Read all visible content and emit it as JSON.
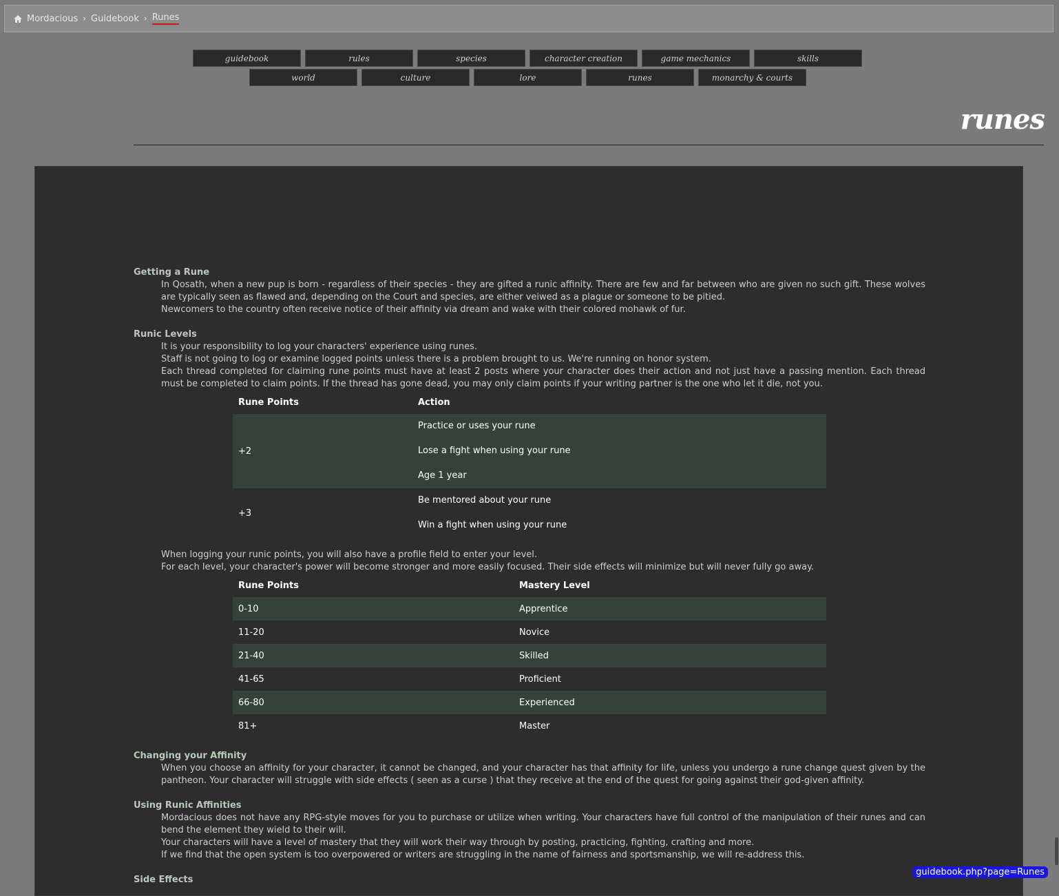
{
  "breadcrumb": {
    "items": [
      "Mordacious",
      "Guidebook"
    ],
    "current": "Runes"
  },
  "nav": {
    "row1": [
      "guidebook",
      "rules",
      "species",
      "character creation",
      "game mechanics",
      "skills"
    ],
    "row2": [
      "world",
      "culture",
      "lore",
      "runes",
      "monarchy & courts"
    ]
  },
  "page_title": "runes",
  "getting_rune": {
    "heading": "Getting a Rune",
    "p1": "In Qosath, when a new pup is born - regardless of their species - they are gifted a runic affinity. There are few and far between who are given no such gift. These wolves are typically seen as flawed and, depending on the Court and species, are either veiwed as a plague or someone to be pitied.",
    "p2": "Newcomers to the country often receive notice of their affinity via dream and wake with their colored mohawk of fur."
  },
  "runic_levels": {
    "heading": "Runic Levels",
    "p1": "It is your responsibility to log your characters' experience using runes.",
    "p2": "Staff is not going to log or examine logged points unless there is a problem brought to us. We're running on honor system.",
    "p3": "Each thread completed for claiming rune points must have at least 2 posts where your character does their action and not just have a passing mention. Each thread must be completed to claim points. If the thread has gone dead, you may only claim points if your writing partner is the one who let it die, not you."
  },
  "points_table": {
    "headers": [
      "Rune Points",
      "Action"
    ],
    "rows": [
      {
        "points": "+2",
        "actions": [
          "Practice or uses your rune",
          "Lose a fight when using your rune",
          "Age 1 year"
        ]
      },
      {
        "points": "+3",
        "actions": [
          "Be mentored about your rune",
          "Win a fight when using your rune"
        ]
      }
    ]
  },
  "levels_intro": {
    "p1": "When logging your runic points, you will also have a profile field to enter your level.",
    "p2": "For each level, your character's power will become stronger and more easily focused. Their side effects will minimize but will never fully go away."
  },
  "levels_table": {
    "headers": [
      "Rune Points",
      "Mastery Level"
    ],
    "rows": [
      [
        "0-10",
        "Apprentice"
      ],
      [
        "11-20",
        "Novice"
      ],
      [
        "21-40",
        "Skilled"
      ],
      [
        "41-65",
        "Proficient"
      ],
      [
        "66-80",
        "Experienced"
      ],
      [
        "81+",
        "Master"
      ]
    ]
  },
  "changing_affinity": {
    "heading": "Changing your Affinity",
    "p1": "When you choose an affinity for your character, it cannot be changed, and your character has that affinity for life, unless you undergo a rune change quest given by the pantheon. Your character will struggle with side effects ( seen as a curse ) that they receive at the end of the quest for going against their god-given affinity."
  },
  "using_affinities": {
    "heading": "Using Runic Affinities",
    "p1": "Mordacious does not have any RPG-style moves for you to purchase or utilize when writing. Your characters have full control of the manipulation of their runes and can bend the element they wield to their will.",
    "p2": "Your characters will have a level of mastery that they will work their way through by posting, practicing, fighting, crafting and more.",
    "p3": "If we find that the open system is too overpowered or writers are struggling in the name of fairness and sportsmanship, we will re-address this."
  },
  "side_effects": {
    "heading": "Side Effects"
  },
  "status_url": "guidebook.php?page=Runes"
}
